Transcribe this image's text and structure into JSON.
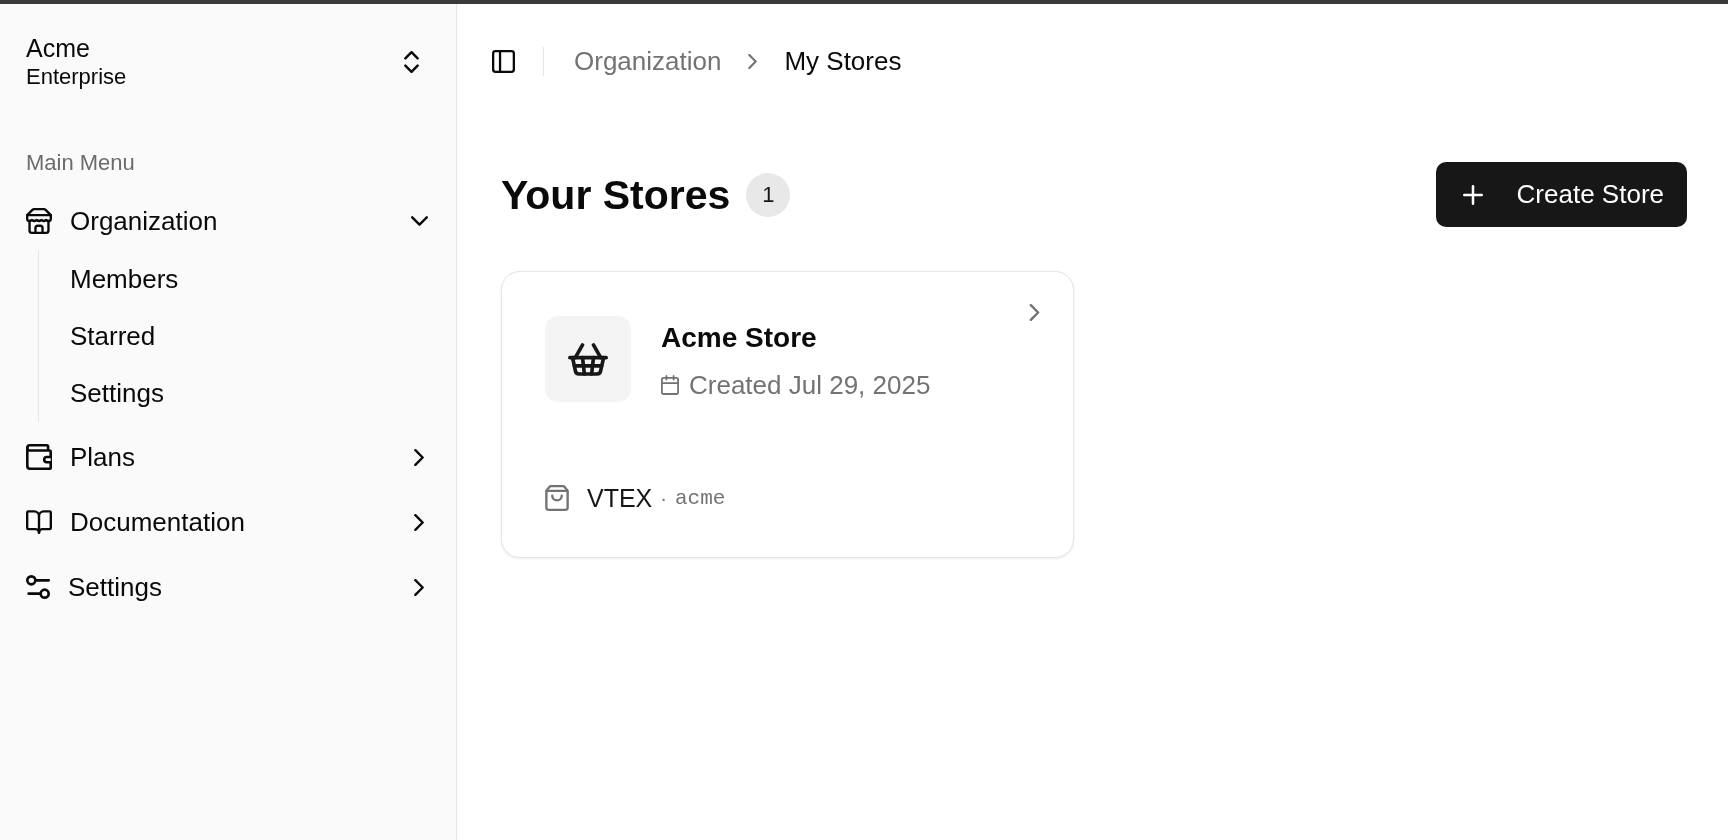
{
  "sidebar": {
    "organization": {
      "name": "Acme",
      "plan": "Enterprise"
    },
    "section_label": "Main Menu",
    "items": [
      {
        "label": "Organization",
        "expanded": true,
        "children": [
          {
            "label": "Members"
          },
          {
            "label": "Starred"
          },
          {
            "label": "Settings"
          }
        ]
      },
      {
        "label": "Plans",
        "expanded": false
      },
      {
        "label": "Documentation",
        "expanded": false
      },
      {
        "label": "Settings",
        "expanded": false
      }
    ]
  },
  "breadcrumbs": [
    {
      "label": "Organization",
      "current": false
    },
    {
      "label": "My Stores",
      "current": true
    }
  ],
  "page": {
    "title": "Your Stores",
    "count": "1",
    "create_button": "Create Store"
  },
  "stores": [
    {
      "name": "Acme Store",
      "created": "Created Jul 29, 2025",
      "platform": "VTEX",
      "separator": "·",
      "handle": "acme"
    }
  ]
}
